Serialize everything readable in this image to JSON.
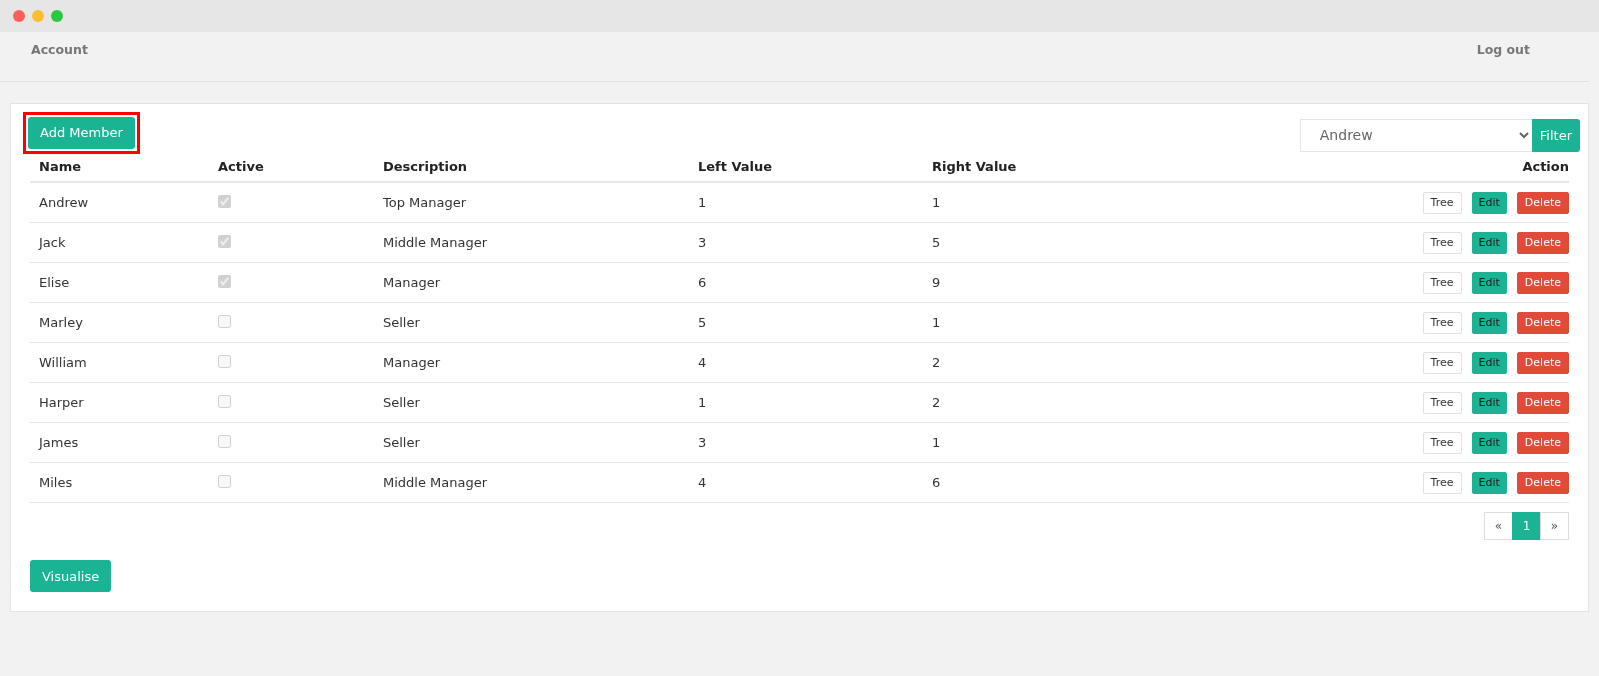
{
  "nav": {
    "left": "Account",
    "right": "Log out"
  },
  "toolbar": {
    "add_button": "Add Member",
    "highlighted": true,
    "filter_select": "Andrew",
    "filter_button": "Filter"
  },
  "table": {
    "columns": [
      "Name",
      "Active",
      "Description",
      "Left Value",
      "Right Value",
      "Action"
    ],
    "rows": [
      {
        "name": "Andrew",
        "active": true,
        "description": "Top Manager",
        "left_value": "1",
        "right_value": "1",
        "actions": [
          "Tree",
          "Edit",
          "Delete"
        ]
      },
      {
        "name": "Jack",
        "active": true,
        "description": "Middle Manager",
        "left_value": "3",
        "right_value": "5",
        "actions": [
          "Tree",
          "Edit",
          "Delete"
        ]
      },
      {
        "name": "Elise",
        "active": true,
        "description": "Manager",
        "left_value": "6",
        "right_value": "9",
        "actions": [
          "Tree",
          "Edit",
          "Delete"
        ]
      },
      {
        "name": "Marley",
        "active": false,
        "description": "Seller",
        "left_value": "5",
        "right_value": "1",
        "actions": [
          "Tree",
          "Edit",
          "Delete"
        ]
      },
      {
        "name": "William",
        "active": false,
        "description": "Manager",
        "left_value": "4",
        "right_value": "2",
        "actions": [
          "Tree",
          "Edit",
          "Delete"
        ]
      },
      {
        "name": "Harper",
        "active": false,
        "description": "Seller",
        "left_value": "1",
        "right_value": "2",
        "actions": [
          "Tree",
          "Edit",
          "Delete"
        ]
      },
      {
        "name": "James",
        "active": false,
        "description": "Seller",
        "left_value": "3",
        "right_value": "1",
        "actions": [
          "Tree",
          "Edit",
          "Delete"
        ]
      },
      {
        "name": "Miles",
        "active": false,
        "description": "Middle Manager",
        "left_value": "4",
        "right_value": "6",
        "actions": [
          "Tree",
          "Edit",
          "Delete"
        ]
      }
    ]
  },
  "pagination": [
    {
      "label": "«",
      "selected": false
    },
    {
      "label": "1",
      "selected": true
    },
    {
      "label": "»",
      "selected": false
    }
  ],
  "visualise_button": "Visualise"
}
